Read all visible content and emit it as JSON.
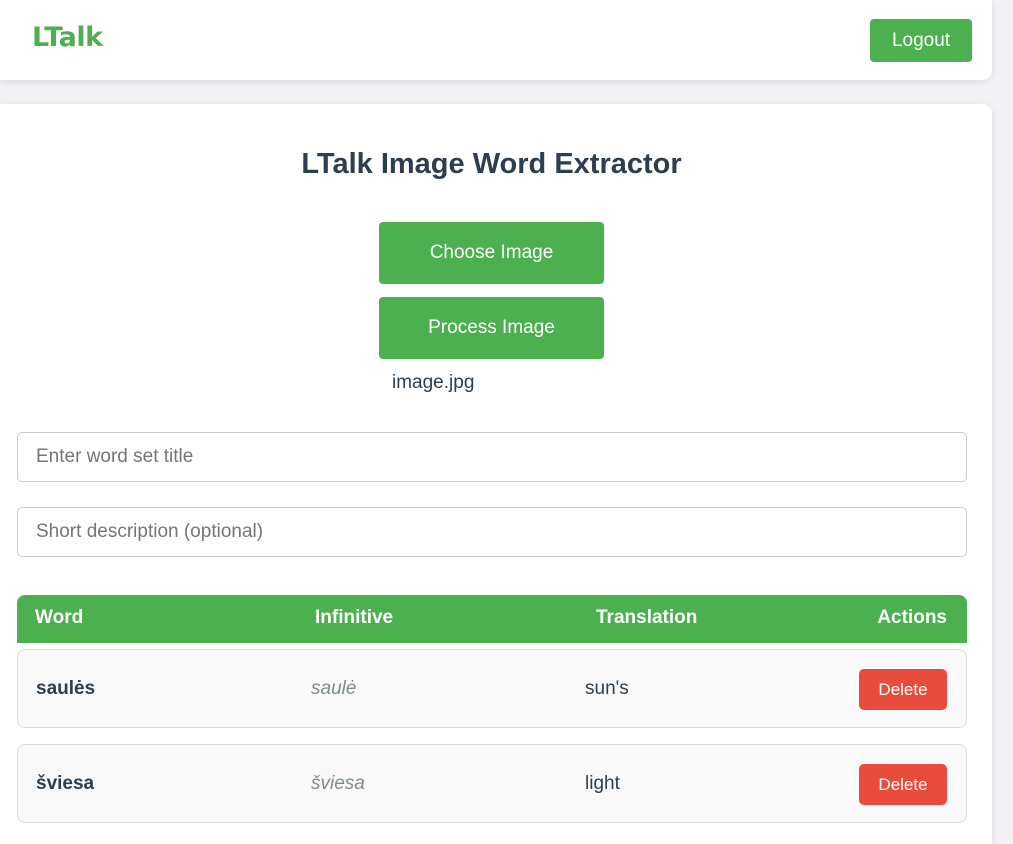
{
  "navbar": {
    "brand": "LTalk",
    "logout_label": "Logout"
  },
  "main": {
    "title": "LTalk Image Word Extractor",
    "choose_image_label": "Choose Image",
    "process_image_label": "Process Image",
    "selected_file": "image.jpg",
    "title_input": {
      "value": "",
      "placeholder": "Enter word set title"
    },
    "description_input": {
      "value": "",
      "placeholder": "Short description (optional)"
    }
  },
  "table": {
    "headers": {
      "word": "Word",
      "infinitive": "Infinitive",
      "translation": "Translation",
      "actions": "Actions"
    },
    "rows": [
      {
        "word": "saulės",
        "infinitive": "saulė",
        "translation": "sun's",
        "action_label": "Delete"
      },
      {
        "word": "šviesa",
        "infinitive": "šviesa",
        "translation": "light",
        "action_label": "Delete"
      }
    ]
  },
  "colors": {
    "accent_green": "#4caf50",
    "delete_red": "#e74c3c",
    "heading_text": "#2c3e50",
    "muted_text": "#7f8c8d"
  }
}
